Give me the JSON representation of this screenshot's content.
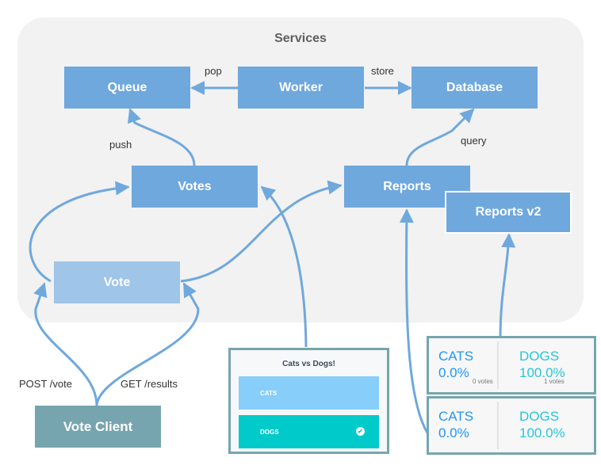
{
  "services": {
    "title": "Services"
  },
  "nodes": {
    "queue": "Queue",
    "worker": "Worker",
    "database": "Database",
    "votes": "Votes",
    "reports": "Reports",
    "reports_v2": "Reports v2",
    "vote": "Vote",
    "vote_client": "Vote Client"
  },
  "edges": {
    "pop": "pop",
    "store": "store",
    "push": "push",
    "query": "query",
    "post_vote": "POST /vote",
    "get_results": "GET /results"
  },
  "vote_ui": {
    "title": "Cats vs Dogs!",
    "options": [
      {
        "label": "CATS",
        "selected": false
      },
      {
        "label": "DOGS",
        "selected": true
      }
    ],
    "check_icon": "✔"
  },
  "results_v2": {
    "cats_label": "CATS",
    "cats_pct": "0.0%",
    "cats_votes": "0 votes",
    "dogs_label": "DOGS",
    "dogs_pct": "100.0%",
    "dogs_votes": "1 votes"
  },
  "results_v1": {
    "cats_label": "CATS",
    "cats_pct": "0.0%",
    "dogs_label": "DOGS",
    "dogs_pct": "100.0%"
  },
  "colors": {
    "service": "#6fa8dc",
    "service_light": "#9fc5e8",
    "client": "#76a5af",
    "arrow": "#6fa8dc",
    "cats": "#2196f3",
    "dogs": "#26c6da"
  }
}
